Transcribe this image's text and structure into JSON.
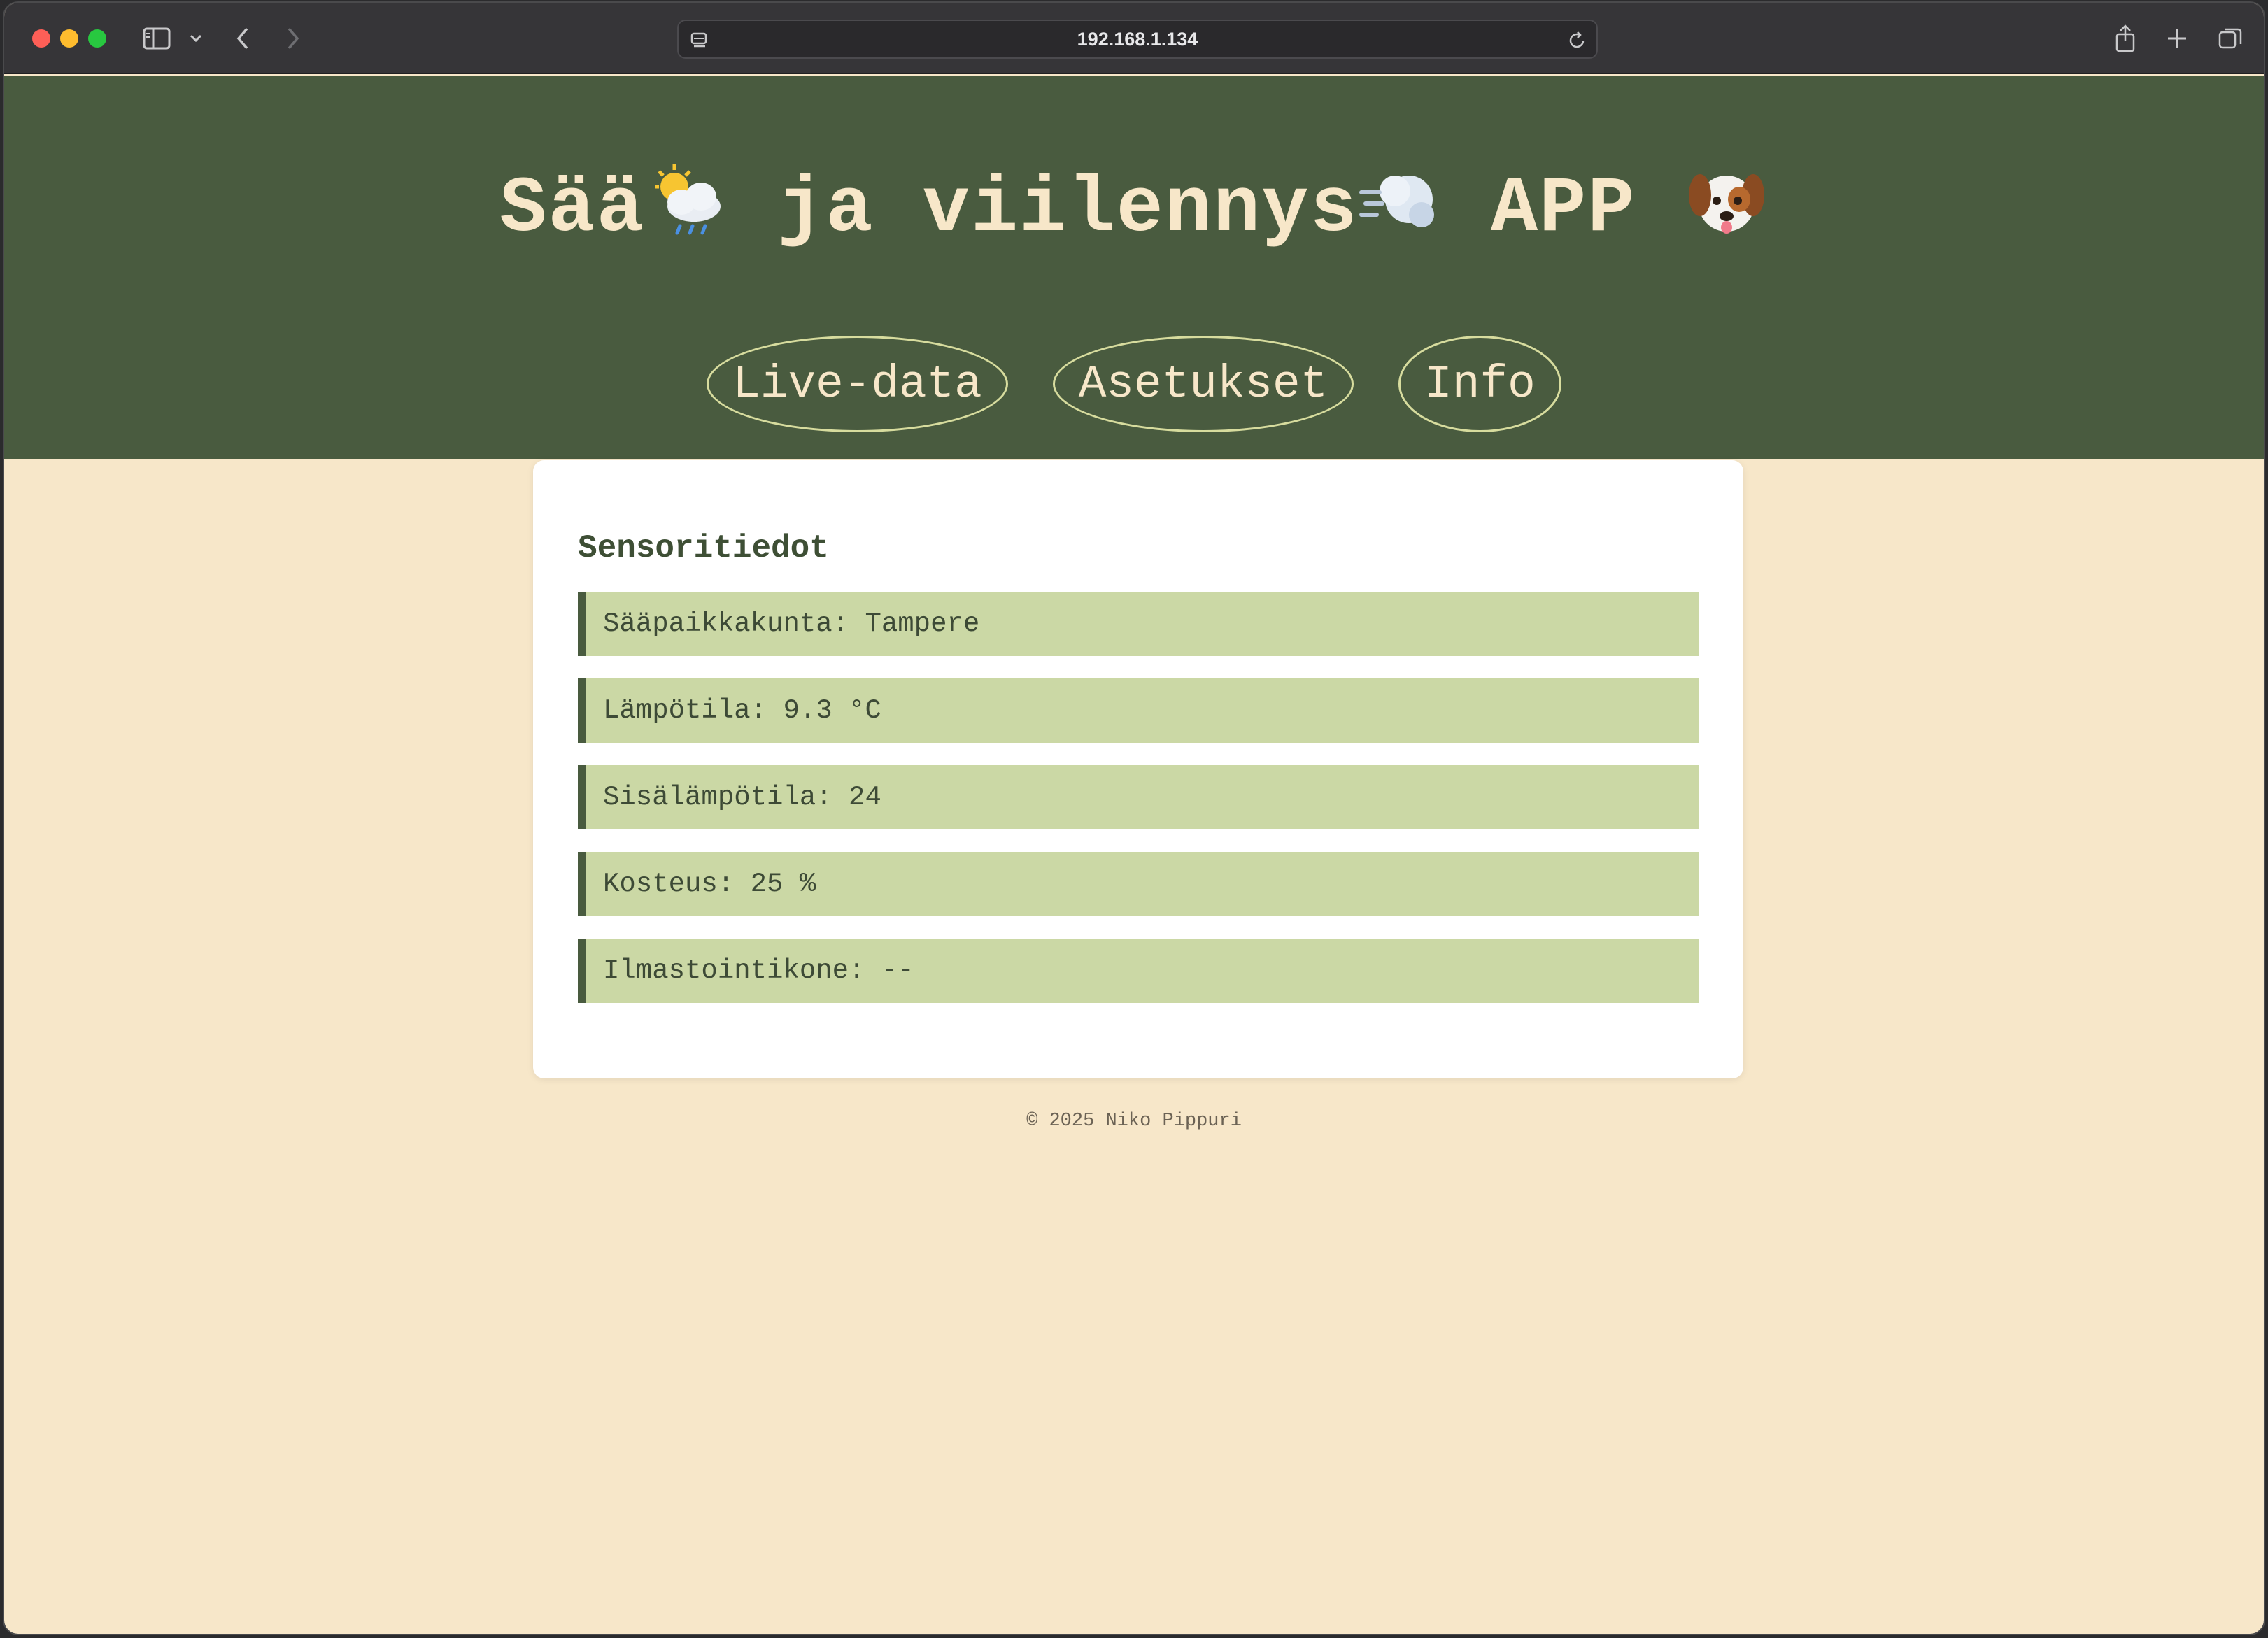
{
  "browser": {
    "url": "192.168.1.134"
  },
  "header": {
    "title_part1": "Sää",
    "title_part2": " ja viilennys",
    "title_part3": " APP ",
    "nav": [
      {
        "label": "Live-data"
      },
      {
        "label": "Asetukset"
      },
      {
        "label": "Info"
      }
    ]
  },
  "card": {
    "title": "Sensoritiedot",
    "rows": [
      {
        "label": "Sääpaikkakunta: Tampere"
      },
      {
        "label": "Lämpötila: 9.3 °C"
      },
      {
        "label": "Sisälämpötila: 24"
      },
      {
        "label": "Kosteus: 25 %"
      },
      {
        "label": "Ilmastointikone: --"
      }
    ]
  },
  "footer": {
    "text": "© 2025 Niko Pippuri"
  },
  "colors": {
    "header_bg": "#495b3f",
    "page_bg": "#f7e7c9",
    "row_bg": "#cbd8a5",
    "accent_text": "#f7e7c9"
  }
}
